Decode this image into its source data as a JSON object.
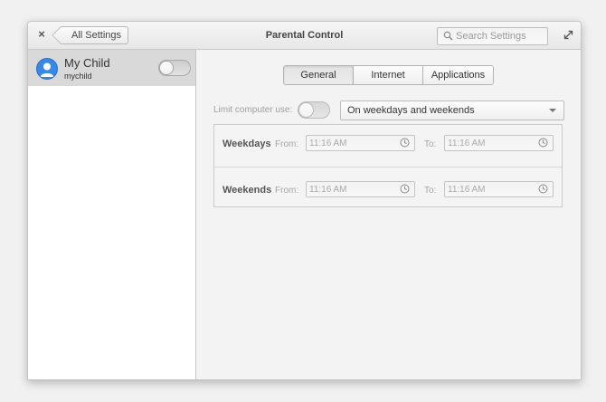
{
  "window": {
    "title": "Parental Control",
    "back_label": "All Settings",
    "search_placeholder": "Search Settings",
    "close_glyph": "×"
  },
  "sidebar": {
    "users": [
      {
        "name": "My Child",
        "login": "mychild",
        "avatar_icon": "user-avatar-icon",
        "enabled": false
      }
    ]
  },
  "tabs": [
    {
      "label": "General",
      "active": true
    },
    {
      "label": "Internet",
      "active": false
    },
    {
      "label": "Applications",
      "active": false
    }
  ],
  "general": {
    "limit_label": "Limit computer use:",
    "limit_enabled": false,
    "schedule_selected": "On weekdays and weekends",
    "rows": [
      {
        "title": "Weekdays",
        "from_label": "From:",
        "from_value": "11:16 AM",
        "to_label": "To:",
        "to_value": "11:16 AM"
      },
      {
        "title": "Weekends",
        "from_label": "From:",
        "from_value": "11:16 AM",
        "to_label": "To:",
        "to_value": "11:16 AM"
      }
    ]
  },
  "colors": {
    "accent": "#3689e6",
    "selection_bg": "#d9d9d9"
  }
}
